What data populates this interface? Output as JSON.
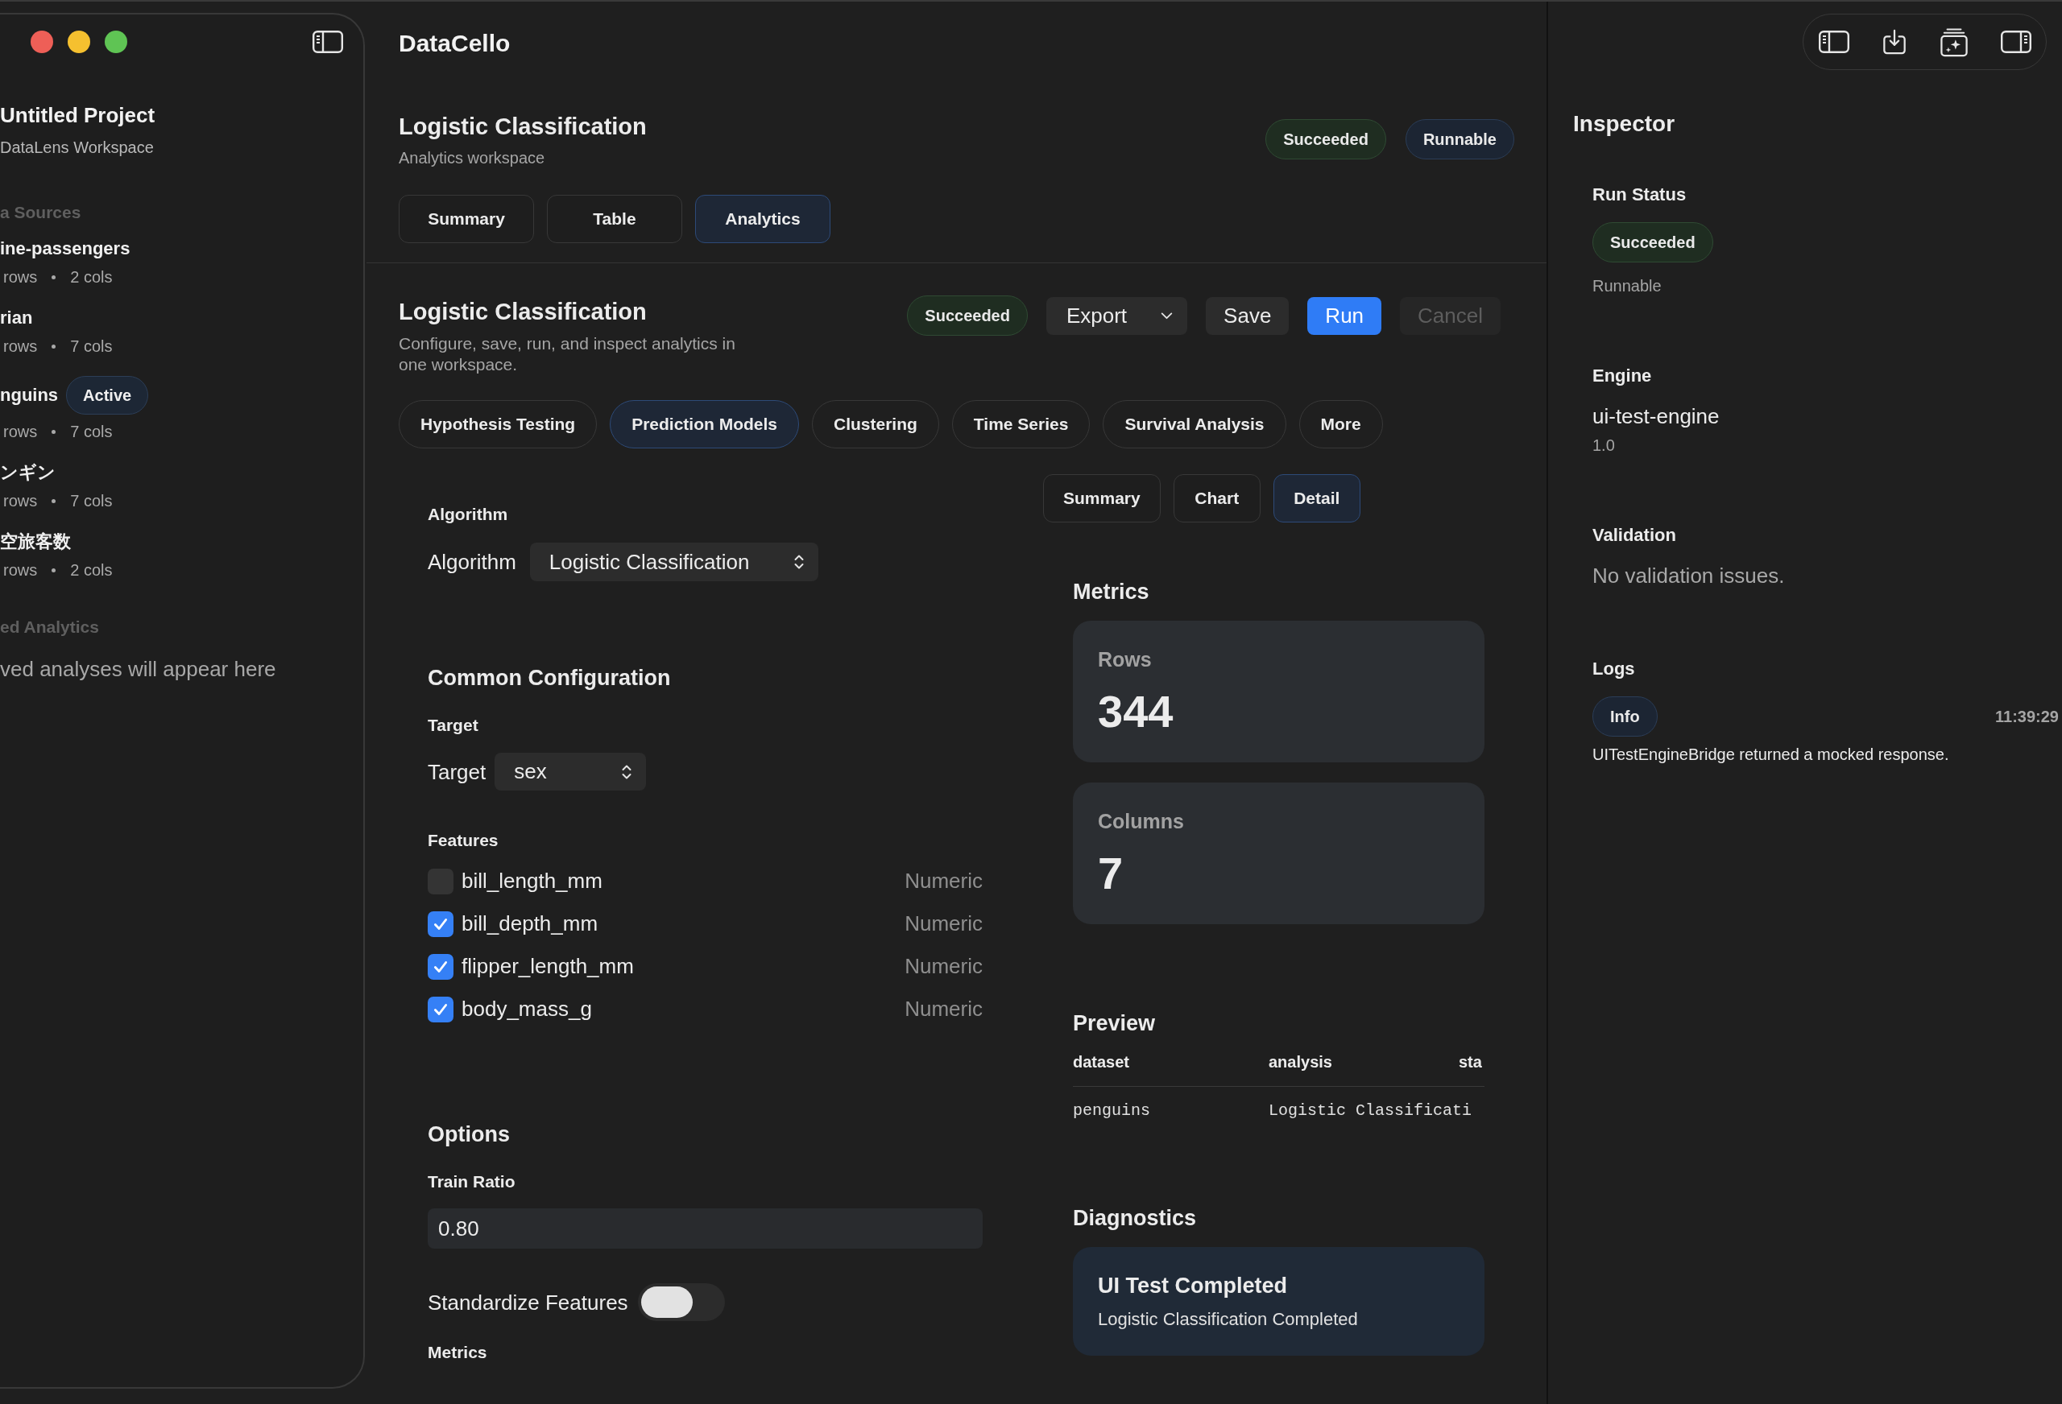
{
  "sidebar": {
    "project_title": "Untitled Project",
    "project_subtitle": "DataLens Workspace",
    "sources_heading": "a Sources",
    "sources": [
      {
        "name": "ine-passengers",
        "rows": "rows",
        "cols": "2 cols"
      },
      {
        "name": "rian",
        "rows": "rows",
        "cols": "7 cols"
      },
      {
        "name": "nguins",
        "badge": "Active",
        "rows": "rows",
        "cols": "7 cols"
      },
      {
        "name": "ンギン",
        "rows": "rows",
        "cols": "7 cols"
      },
      {
        "name": "空旅客数",
        "rows": "rows",
        "cols": "2 cols"
      }
    ],
    "saved_heading": "ed Analytics",
    "saved_empty": "ved analyses will appear here"
  },
  "main": {
    "app_title": "DataCello",
    "header": {
      "title": "Logistic Classification",
      "subtitle": "Analytics workspace",
      "badges": [
        {
          "label": "Succeeded",
          "kind": "success"
        },
        {
          "label": "Runnable",
          "kind": "info"
        }
      ],
      "tabs": [
        {
          "label": "Summary",
          "selected": false
        },
        {
          "label": "Table",
          "selected": false
        },
        {
          "label": "Analytics",
          "selected": true
        }
      ]
    },
    "analysis": {
      "title": "Logistic Classification",
      "description": "Configure, save, run, and inspect analytics in one workspace.",
      "status": {
        "label": "Succeeded",
        "kind": "success"
      },
      "actions": [
        {
          "label": "Export",
          "kind": "menu",
          "disabled": false
        },
        {
          "label": "Save",
          "kind": "plain",
          "disabled": false
        },
        {
          "label": "Run",
          "kind": "primary",
          "disabled": false
        },
        {
          "label": "Cancel",
          "kind": "plain",
          "disabled": true
        }
      ],
      "categories": [
        {
          "label": "Hypothesis Testing",
          "selected": false
        },
        {
          "label": "Prediction Models",
          "selected": true
        },
        {
          "label": "Clustering",
          "selected": false
        },
        {
          "label": "Time Series",
          "selected": false
        },
        {
          "label": "Survival Analysis",
          "selected": false
        },
        {
          "label": "More",
          "selected": false
        }
      ],
      "views": [
        {
          "label": "Summary",
          "selected": false
        },
        {
          "label": "Chart",
          "selected": false
        },
        {
          "label": "Detail",
          "selected": true
        }
      ],
      "config": {
        "algorithm_heading": "Algorithm",
        "algorithm": {
          "label": "Algorithm",
          "value": "Logistic Classification"
        },
        "common_heading": "Common Configuration",
        "target_heading": "Target",
        "target": {
          "label": "Target",
          "value": "sex"
        },
        "features_heading": "Features",
        "features": [
          {
            "name": "bill_length_mm",
            "type": "Numeric",
            "checked": false
          },
          {
            "name": "bill_depth_mm",
            "type": "Numeric",
            "checked": true
          },
          {
            "name": "flipper_length_mm",
            "type": "Numeric",
            "checked": true
          },
          {
            "name": "body_mass_g",
            "type": "Numeric",
            "checked": true
          }
        ],
        "options_heading": "Options",
        "train_ratio": {
          "label": "Train Ratio",
          "value": "0.80"
        },
        "standardize": {
          "label": "Standardize Features",
          "on": false
        },
        "metrics_heading": "Metrics"
      },
      "results": {
        "metrics_heading": "Metrics",
        "metrics": [
          {
            "label": "Rows",
            "value": "344"
          },
          {
            "label": "Columns",
            "value": "7"
          }
        ],
        "preview_heading": "Preview",
        "preview": {
          "columns": [
            "dataset",
            "analysis",
            "sta"
          ],
          "rows": [
            [
              "penguins",
              "Logistic Classificati"
            ]
          ]
        },
        "diagnostics_heading": "Diagnostics",
        "diagnostics": [
          {
            "title": "UI Test Completed",
            "message": "Logistic Classification Completed"
          }
        ]
      }
    }
  },
  "inspector": {
    "title": "Inspector",
    "run_status": {
      "heading": "Run Status",
      "badge": {
        "label": "Succeeded",
        "kind": "success"
      },
      "note": "Runnable"
    },
    "engine": {
      "heading": "Engine",
      "name": "ui-test-engine",
      "version": "1.0"
    },
    "validation": {
      "heading": "Validation",
      "message": "No validation issues."
    },
    "logs": {
      "heading": "Logs",
      "entries": [
        {
          "badge": {
            "label": "Info",
            "kind": "info"
          },
          "time": "11:39:29",
          "message": "UITestEngineBridge returned a mocked response."
        }
      ]
    }
  }
}
